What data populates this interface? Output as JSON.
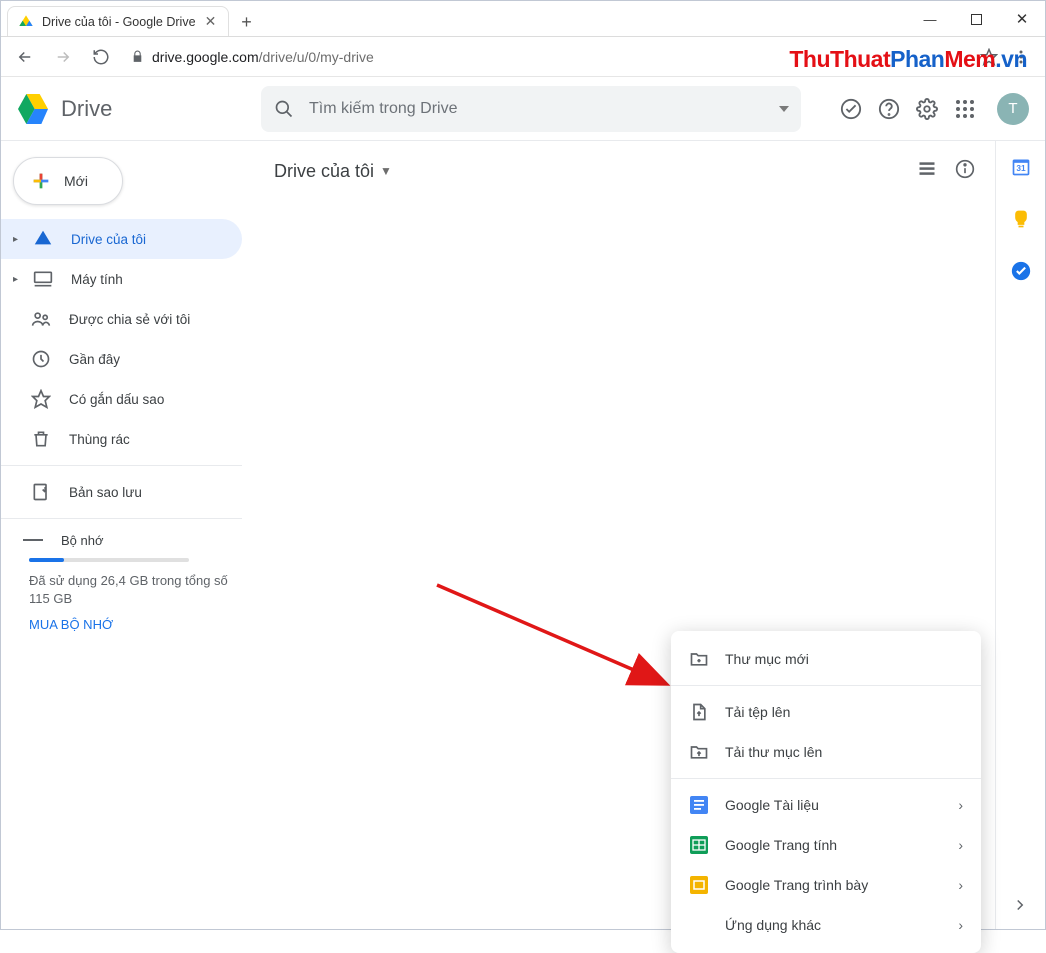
{
  "window": {
    "tab_title": "Drive của tôi - Google Drive",
    "minimize": "—",
    "maximize": "▢",
    "close": "✕",
    "new_tab": "+"
  },
  "addressbar": {
    "back": "←",
    "forward": "→",
    "reload": "⟳",
    "lock": "🔒",
    "url_domain": "drive.google.com",
    "url_path": "/drive/u/0/my-drive",
    "star": "☆",
    "menu": "⋮"
  },
  "gd_header": {
    "logo_text": "Drive",
    "search_placeholder": "Tìm kiếm trong Drive",
    "avatar_letter": "T"
  },
  "new_button": "Mới",
  "sidebar": {
    "items": [
      {
        "label": "Drive của tôi",
        "active": true,
        "expand": true
      },
      {
        "label": "Máy tính",
        "active": false,
        "expand": true
      },
      {
        "label": "Được chia sẻ với tôi"
      },
      {
        "label": "Gần đây"
      },
      {
        "label": "Có gắn dấu sao"
      },
      {
        "label": "Thùng rác"
      }
    ],
    "backups": "Bản sao lưu",
    "storage_label": "Bộ nhớ",
    "storage_text": "Đã sử dụng 26,4 GB trong tổng số 115 GB",
    "buy_link": "MUA BỘ NHỚ"
  },
  "location": {
    "title": "Drive của tôi"
  },
  "context_menu": {
    "new_folder": "Thư mục mới",
    "upload_file": "Tải tệp lên",
    "upload_folder": "Tải thư mục lên",
    "google_docs": "Google Tài liệu",
    "google_sheets": "Google Trang tính",
    "google_slides": "Google Trang trình bày",
    "more_apps": "Ứng dụng khác"
  },
  "watermark": {
    "p1": "ThuThuat",
    "p2": "Phan",
    "p3": "Mem",
    "p4": ".vn"
  }
}
